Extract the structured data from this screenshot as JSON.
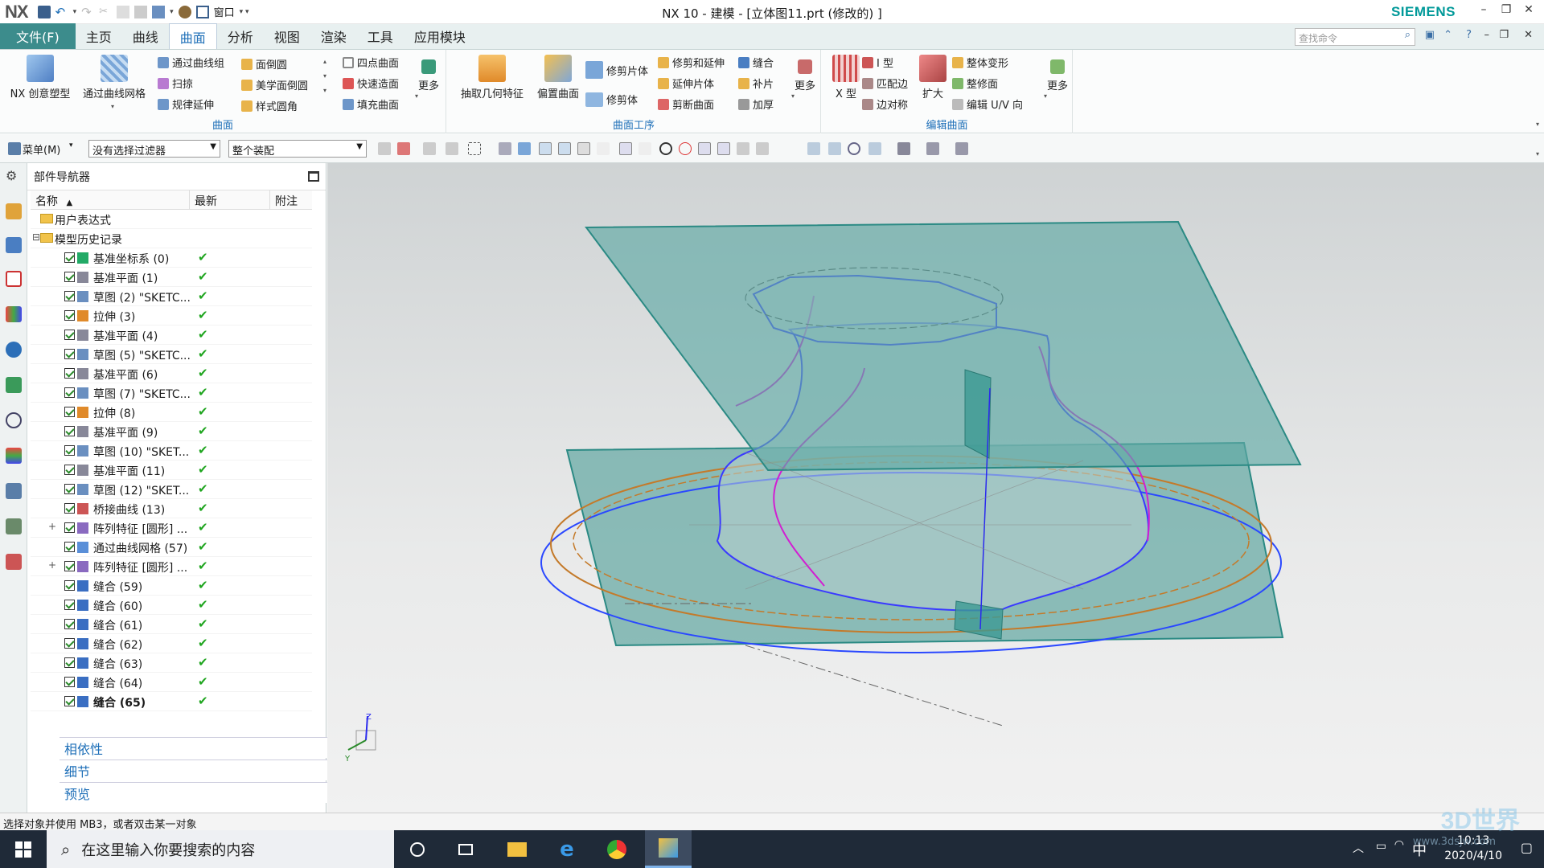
{
  "app": {
    "logo": "NX",
    "title": "NX 10 - 建模 - [立体图11.prt  (修改的) ]",
    "brand": "SIEMENS",
    "window_menu": "窗口"
  },
  "tabs": {
    "file": "文件(F)",
    "items": [
      "主页",
      "曲线",
      "曲面",
      "分析",
      "视图",
      "渲染",
      "工具",
      "应用模块"
    ],
    "active": "曲面",
    "search_placeholder": "查找命令"
  },
  "ribbon": {
    "group1": {
      "label": "曲面",
      "big1": "NX 创意塑型",
      "big2": "通过曲线网格",
      "s1": "通过曲线组",
      "s2": "扫掠",
      "s3": "规律延伸",
      "s4": "面倒圆",
      "s5": "美学面倒圆",
      "s6": "样式圆角",
      "s7": "四点曲面",
      "s8": "快速造面",
      "s9": "填充曲面",
      "more": "更多"
    },
    "group2": {
      "label": "曲面工序",
      "big1": "抽取几何特征",
      "big2": "偏置曲面",
      "s1": "修剪片体",
      "s2": "修剪体",
      "s3": "修剪和延伸",
      "s4": "延伸片体",
      "s5": "剪断曲面",
      "s6": "缝合",
      "s7": "补片",
      "s8": "加厚",
      "more": "更多"
    },
    "group3": {
      "label": "编辑曲面",
      "big1": "X 型",
      "s1": "I 型",
      "s2": "匹配边",
      "s3": "边对称",
      "big2": "扩大",
      "s4": "整体变形",
      "s5": "整修面",
      "s6": "编辑 U/V 向",
      "more": "更多"
    }
  },
  "toolbar2": {
    "menu": "菜单(M)",
    "filter": "没有选择过滤器",
    "scope": "整个装配"
  },
  "navigator": {
    "title": "部件导航器",
    "columns": [
      "名称",
      "最新",
      "附注"
    ],
    "top_rows": [
      "用户表达式",
      "模型历史记录"
    ],
    "features": [
      "基准坐标系 (0)",
      "基准平面 (1)",
      "草图 (2) \"SKETC...",
      "拉伸 (3)",
      "基准平面 (4)",
      "草图 (5) \"SKETC...",
      "基准平面 (6)",
      "草图 (7) \"SKETC...",
      "拉伸 (8)",
      "基准平面 (9)",
      "草图 (10) \"SKET...",
      "基准平面 (11)",
      "草图 (12) \"SKET...",
      "桥接曲线 (13)",
      "阵列特征 [圆形] ...",
      "通过曲线网格 (57)",
      "阵列特征 [圆形] ...",
      "缝合 (59)",
      "缝合 (60)",
      "缝合 (61)",
      "缝合 (62)",
      "缝合 (63)",
      "缝合 (64)",
      "缝合 (65)"
    ],
    "panels": [
      "相依性",
      "细节",
      "预览"
    ]
  },
  "status": "选择对象并使用 MB3，或者双击某一对象",
  "taskbar": {
    "search": "在这里输入你要搜索的内容",
    "ime": "中",
    "time": "10:13",
    "date": "2020/4/10"
  },
  "watermark": {
    "brand": "3D世界",
    "url": "www.3dsjw.com"
  },
  "colors": {
    "accent": "#1e6fb8",
    "file_tab": "#3c8c8c",
    "siemens": "#009999",
    "surface_fill": "#5fa9a4",
    "curve_magenta": "#d21ed2",
    "curve_blue": "#3a3aff"
  }
}
